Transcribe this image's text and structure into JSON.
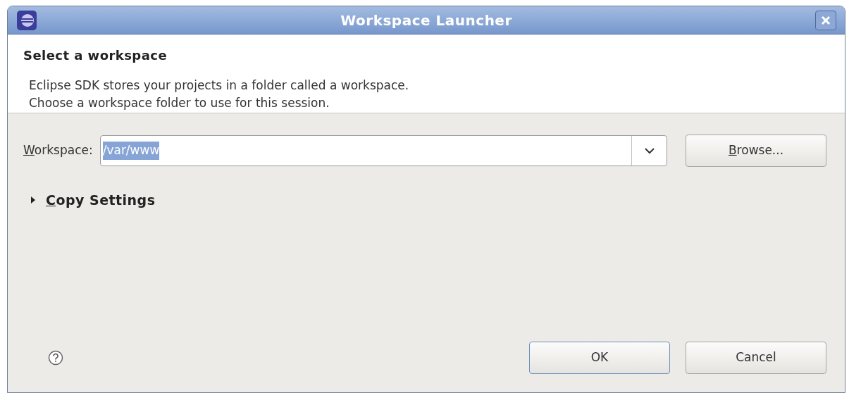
{
  "window": {
    "title": "Workspace Launcher"
  },
  "header": {
    "title": "Select a workspace",
    "description": [
      "Eclipse SDK stores your projects in a folder called a workspace.",
      "Choose a workspace folder to use for this session."
    ]
  },
  "workspace": {
    "label": "Workspace:",
    "label_mnemonic": true,
    "value": "/var/www",
    "value_selected": true,
    "browse": {
      "label": "Browse...",
      "mnemonic": true
    }
  },
  "copy_settings": {
    "label": "Copy Settings",
    "mnemonic": true,
    "expanded": false
  },
  "buttons": [
    {
      "label": "OK",
      "default": true
    },
    {
      "label": "Cancel",
      "default": false
    }
  ]
}
